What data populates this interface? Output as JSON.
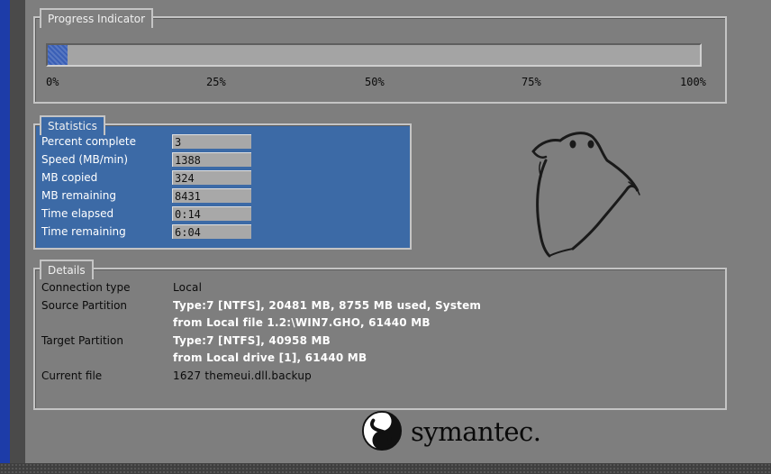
{
  "progress": {
    "title": "Progress Indicator",
    "fraction": 0.03,
    "ticks": [
      "0%",
      "25%",
      "50%",
      "75%",
      "100%"
    ]
  },
  "statistics": {
    "title": "Statistics",
    "rows": [
      {
        "label": "Percent complete",
        "value": "3"
      },
      {
        "label": "Speed (MB/min)",
        "value": "1388"
      },
      {
        "label": "MB copied",
        "value": "324"
      },
      {
        "label": "MB remaining",
        "value": "8431"
      },
      {
        "label": "Time elapsed",
        "value": "0:14"
      },
      {
        "label": "Time remaining",
        "value": "6:04"
      }
    ]
  },
  "details": {
    "title": "Details",
    "connection_type_label": "Connection type",
    "connection_type_value": "Local",
    "source_label": "Source Partition",
    "source_line1": "Type:7 [NTFS], 20481 MB, 8755 MB used, System",
    "source_line2": "from Local file 1.2:\\WIN7.GHO, 61440 MB",
    "target_label": "Target Partition",
    "target_line1": "Type:7 [NTFS], 40958 MB",
    "target_line2": "from Local drive [1], 61440 MB",
    "current_file_label": "Current file",
    "current_file_value": "1627 themeui.dll.backup"
  },
  "brand": {
    "name": "symantec.",
    "accent": "#3c6aa6"
  }
}
